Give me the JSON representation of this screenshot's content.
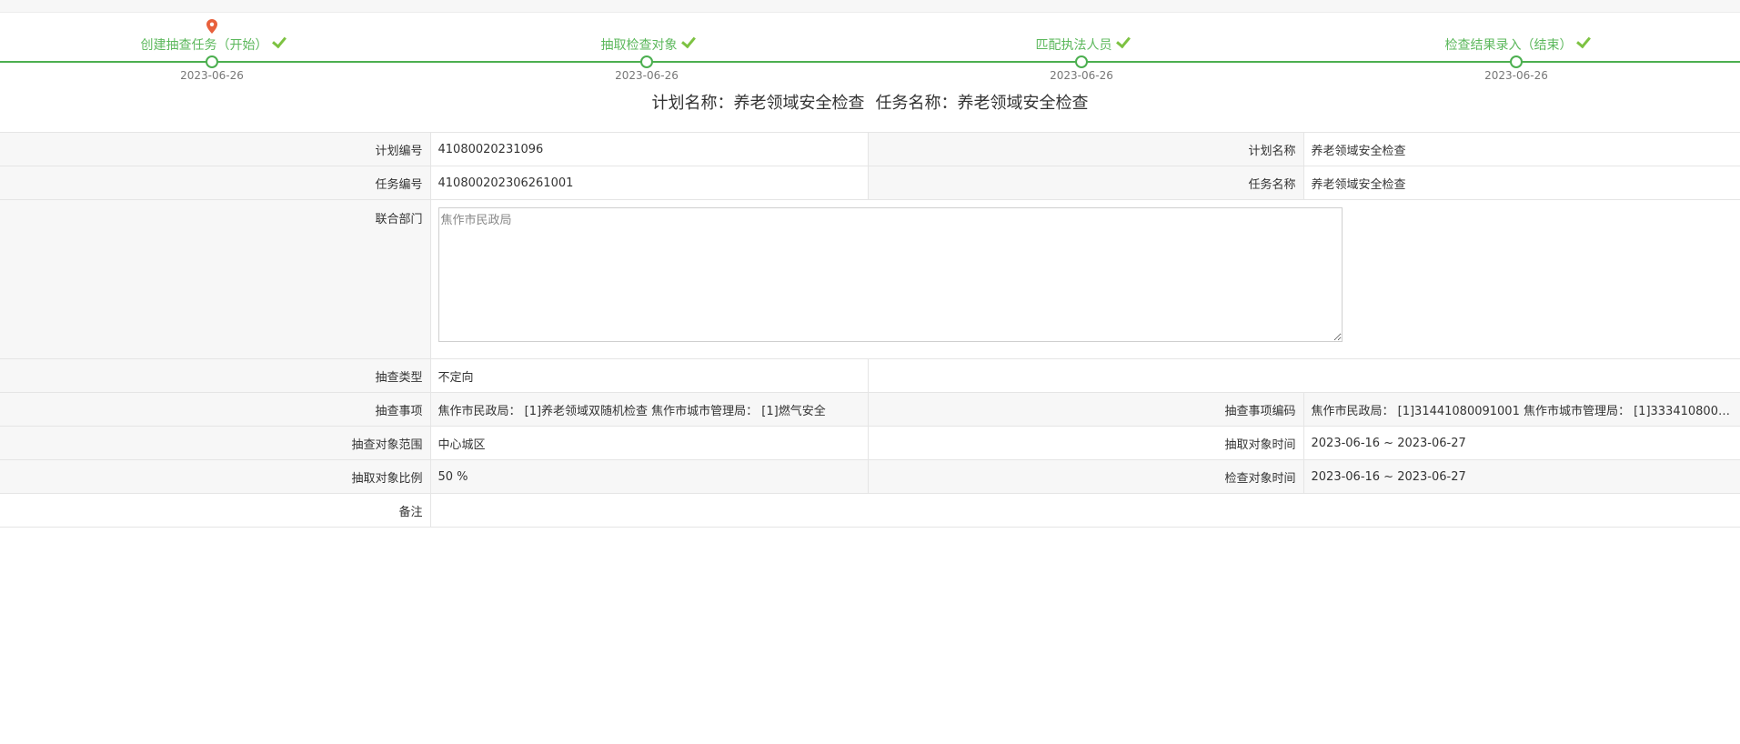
{
  "steps": [
    {
      "label": "创建抽查任务（开始）",
      "date": "2023-06-26"
    },
    {
      "label": "抽取检查对象",
      "date": "2023-06-26"
    },
    {
      "label": "匹配执法人员",
      "date": "2023-06-26"
    },
    {
      "label": "检查结果录入（结束）",
      "date": "2023-06-26"
    }
  ],
  "title": {
    "plan": "计划名称：养老领域安全检查",
    "task": "任务名称：养老领域安全检查"
  },
  "colors": {
    "accent": "#4caf50",
    "check": "#7dc242",
    "pin": "#e8603c"
  },
  "icons": {
    "current_step": "map-pin-icon",
    "done": "check-icon"
  },
  "info": {
    "plan_no_label": "计划编号",
    "plan_no": "41080020231096",
    "plan_name_label": "计划名称",
    "plan_name": "养老领域安全检查",
    "task_no_label": "任务编号",
    "task_no": "410800202306261001",
    "task_name_label": "任务名称",
    "task_name": "养老领域安全检查",
    "joint_dept_label": "联合部门",
    "joint_dept": "焦作市民政局",
    "check_type_label": "抽查类型",
    "check_type": "不定向",
    "check_items_label": "抽查事项",
    "check_items": "焦作市民政局： [1]养老领域双随机检查 焦作市城市管理局： [1]燃气安全",
    "check_codes_label": "抽查事项编码",
    "check_codes": "焦作市民政局： [1]31441080091001 焦作市城市管理局： [1]333410800…",
    "scope_label": "抽查对象范围",
    "scope": "中心城区",
    "draw_time_label": "抽取对象时间",
    "draw_time": "2023-06-16 ~ 2023-06-27",
    "ratio_label": "抽取对象比例",
    "ratio": "50 %",
    "check_time_label": "检查对象时间",
    "check_time": "2023-06-16 ~ 2023-06-27",
    "remark_label": "备注",
    "remark": ""
  }
}
